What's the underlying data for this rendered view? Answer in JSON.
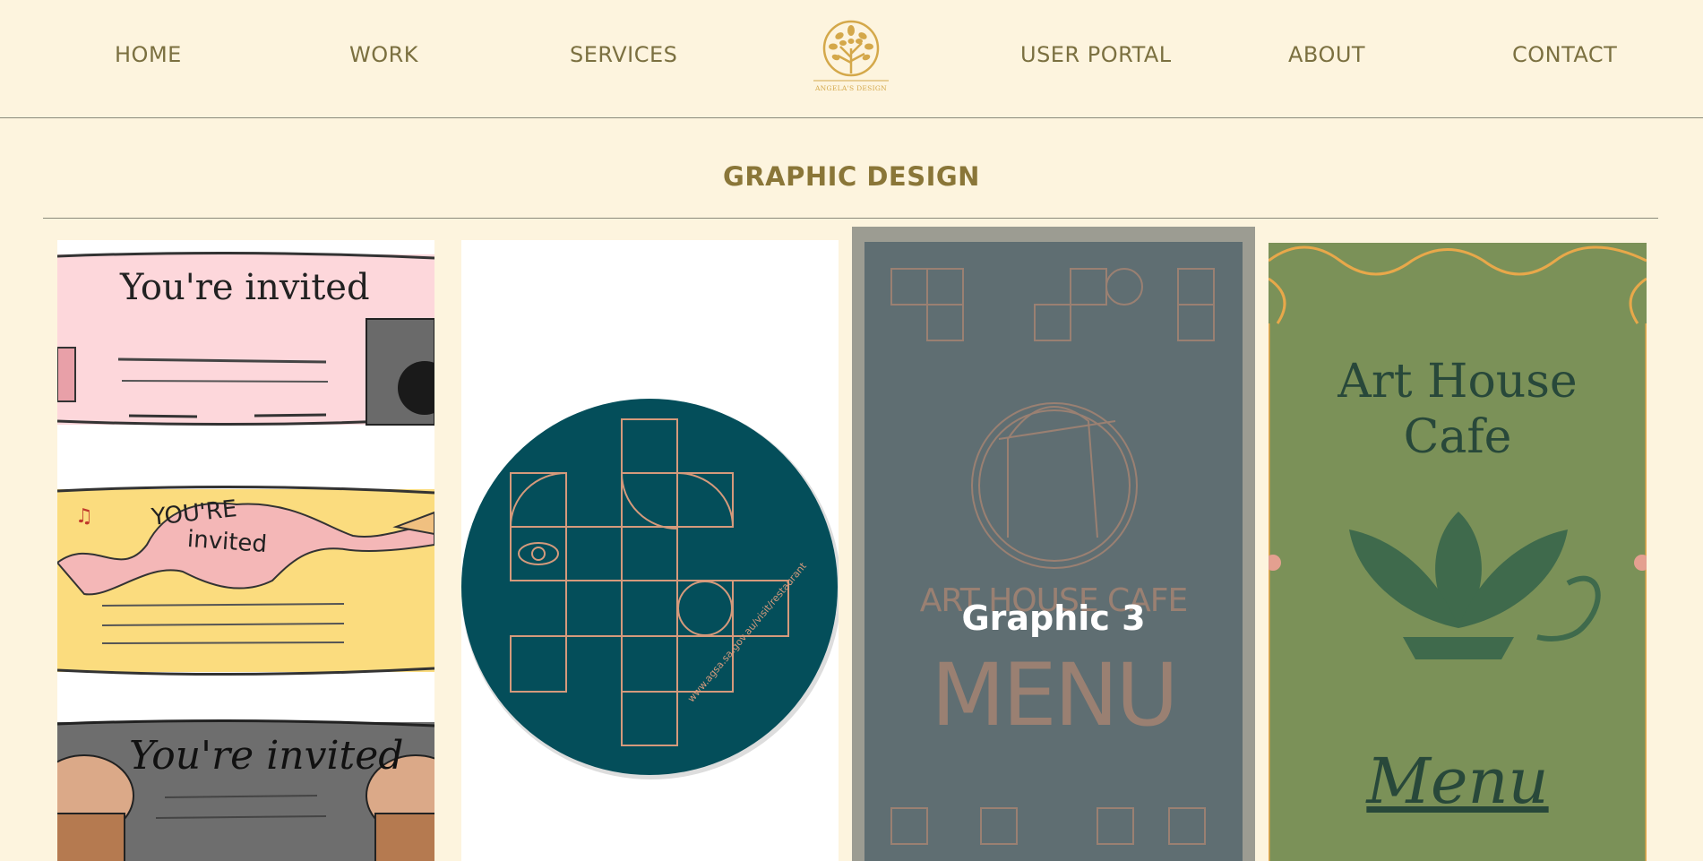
{
  "nav": {
    "items": [
      "HOME",
      "WORK",
      "SERVICES",
      "USER PORTAL",
      "ABOUT",
      "CONTACT"
    ],
    "logo_text": "ANGELA'S DESIGN"
  },
  "page_title": "GRAPHIC DESIGN",
  "gallery": {
    "tile1": {
      "invite_pink": "You're invited",
      "invite_yellow_line1": "YOU'RE",
      "invite_yellow_line2": "invited",
      "invite_grey": "You're invited"
    },
    "tile2": {
      "coaster_url": "www.agsa.sa.gov.au/visit/restaurant"
    },
    "tile3": {
      "cafe_name": "ART HOUSE CAFE",
      "menu": "MENU",
      "hover_label": "Graphic 3"
    },
    "tile4": {
      "title_line1": "Art House",
      "title_line2": "Cafe",
      "menu": "Menu"
    }
  },
  "colors": {
    "background": "#fdf4de",
    "nav_text": "#7b7040",
    "title": "#8a7638",
    "logo": "#d4a84a"
  }
}
